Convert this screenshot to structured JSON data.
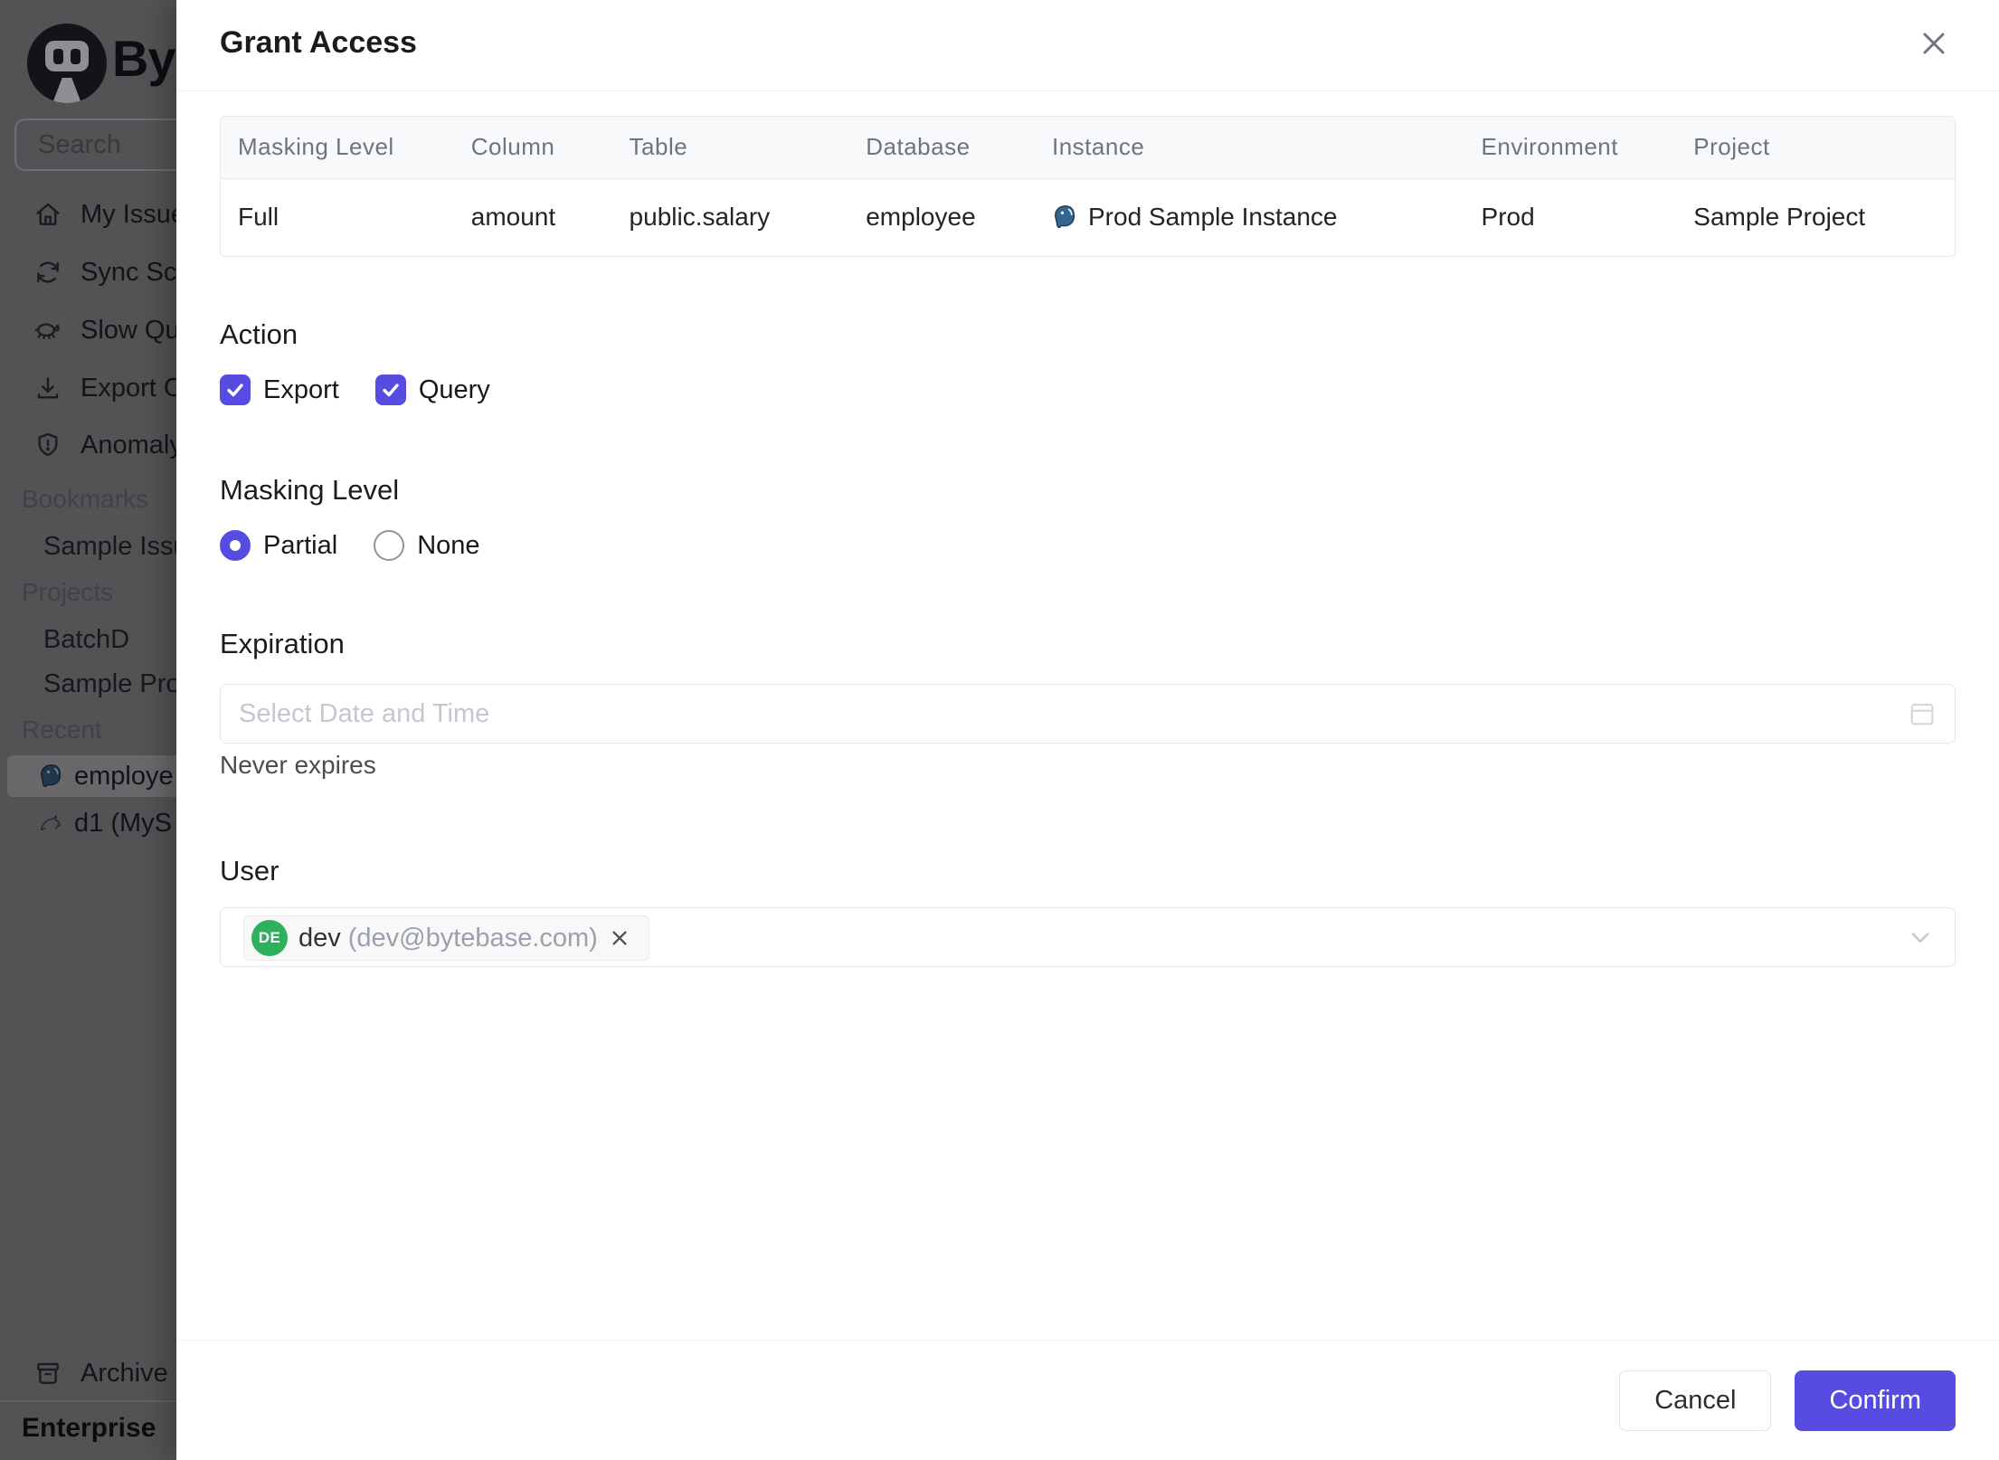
{
  "colors": {
    "accent": "#574ce2",
    "avatar_green": "#2fb05e",
    "postgres_blue": "#336791",
    "overlay_dim": "rgba(0,0,0,0.65)"
  },
  "sidebar": {
    "brand": "By",
    "search_placeholder": "Search",
    "nav": [
      {
        "label": "My Issue",
        "icon": "home"
      },
      {
        "label": "Sync Sc",
        "icon": "sync"
      },
      {
        "label": "Slow Qu",
        "icon": "turtle"
      },
      {
        "label": "Export C",
        "icon": "download"
      },
      {
        "label": "Anomaly",
        "icon": "shield"
      }
    ],
    "sections": [
      {
        "label": "Bookmarks",
        "items": [
          "Sample Issu"
        ]
      },
      {
        "label": "Projects",
        "items": [
          "BatchD",
          "Sample Pro"
        ]
      },
      {
        "label": "Recent",
        "items": [
          {
            "label": "employe",
            "icon": "postgresql",
            "active": true
          },
          {
            "label": "d1 (MyS",
            "icon": "mysql",
            "active": false
          }
        ]
      }
    ],
    "archive_label": "Archive",
    "plan_label": "Enterprise"
  },
  "modal": {
    "title": "Grant Access",
    "close_icon": "close-x",
    "table": {
      "headers": [
        "Masking Level",
        "Column",
        "Table",
        "Database",
        "Instance",
        "Environment",
        "Project"
      ],
      "row": {
        "masking_level": "Full",
        "column": "amount",
        "table": "public.salary",
        "database": "employee",
        "instance": "Prod Sample Instance",
        "instance_icon": "postgresql",
        "environment": "Prod",
        "project": "Sample Project"
      }
    },
    "action": {
      "heading": "Action",
      "options": [
        {
          "label": "Export",
          "checked": true
        },
        {
          "label": "Query",
          "checked": true
        }
      ]
    },
    "masking": {
      "heading": "Masking Level",
      "options": [
        {
          "label": "Partial",
          "selected": true
        },
        {
          "label": "None",
          "selected": false
        }
      ]
    },
    "expiration": {
      "heading": "Expiration",
      "placeholder": "Select Date and Time",
      "value": "",
      "note": "Never expires",
      "icon": "calendar"
    },
    "user": {
      "heading": "User",
      "tag": {
        "initials": "DE",
        "name": "dev",
        "email": "(dev@bytebase.com)"
      }
    },
    "footer": {
      "cancel": "Cancel",
      "confirm": "Confirm"
    }
  }
}
